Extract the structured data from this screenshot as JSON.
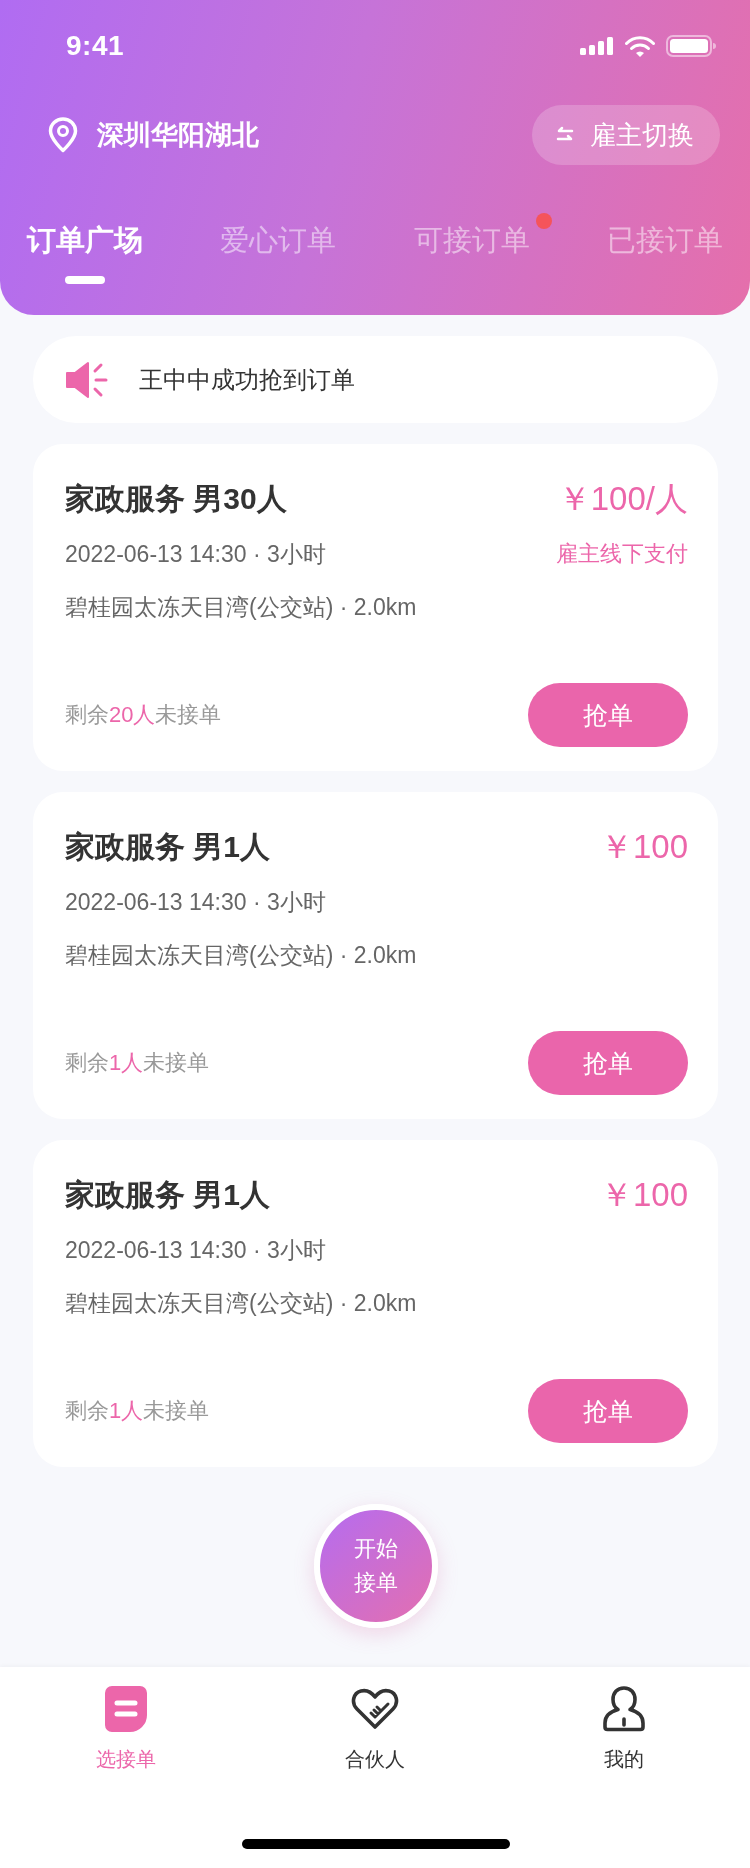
{
  "status_bar": {
    "time": "9:41"
  },
  "location": {
    "name": "深圳华阳湖北"
  },
  "role_switch": {
    "label": "雇主切换"
  },
  "tabs": [
    {
      "label": "订单广场",
      "selected": true,
      "dot": false
    },
    {
      "label": "爱心订单",
      "selected": false,
      "dot": false
    },
    {
      "label": "可接订单",
      "selected": false,
      "dot": true
    },
    {
      "label": "已接订单",
      "selected": false,
      "dot": false
    }
  ],
  "notice": {
    "text": "王中中成功抢到订单"
  },
  "orders": [
    {
      "title": "家政服务 男30人",
      "price": "￥100/人",
      "time": "2022-06-13 14:30 · 3小时",
      "payment_note": "雇主线下支付",
      "address": "碧桂园太冻天目湾(公交站) · 2.0km",
      "remaining_prefix": "剩余",
      "remaining_count": "20人",
      "remaining_suffix": "未接单",
      "button": "抢单"
    },
    {
      "title": "家政服务 男1人",
      "price": "￥100",
      "time": "2022-06-13 14:30 · 3小时",
      "address": "碧桂园太冻天目湾(公交站) · 2.0km",
      "remaining_prefix": "剩余",
      "remaining_count": "1人",
      "remaining_suffix": "未接单",
      "button": "抢单"
    },
    {
      "title": "家政服务 男1人",
      "price": "￥100",
      "time": "2022-06-13 14:30 · 3小时",
      "address": "碧桂园太冻天目湾(公交站) · 2.0km",
      "remaining_prefix": "剩余",
      "remaining_count": "1人",
      "remaining_suffix": "未接单",
      "button": "抢单"
    }
  ],
  "start_button": {
    "label": "开始接单"
  },
  "bottom_nav": [
    {
      "label": "选接单",
      "selected": true
    },
    {
      "label": "合伙人",
      "selected": false
    },
    {
      "label": "我的",
      "selected": false
    }
  ]
}
